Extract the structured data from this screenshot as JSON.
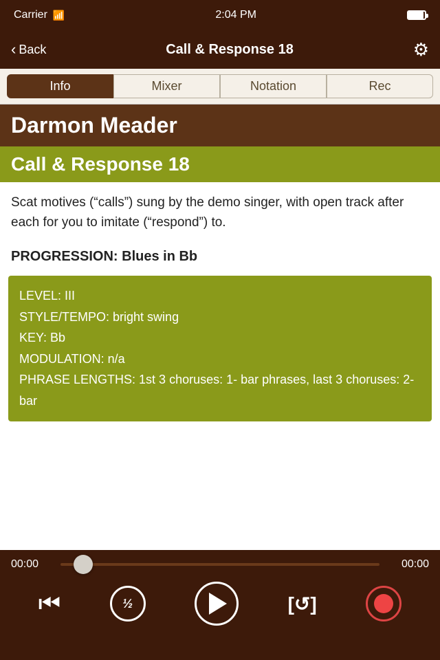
{
  "statusBar": {
    "carrier": "Carrier",
    "time": "2:04 PM"
  },
  "navBar": {
    "backLabel": "Back",
    "title": "Call & Response 18",
    "gearIcon": "⚙"
  },
  "tabs": [
    {
      "id": "info",
      "label": "Info",
      "active": true
    },
    {
      "id": "mixer",
      "label": "Mixer",
      "active": false
    },
    {
      "id": "notation",
      "label": "Notation",
      "active": false
    },
    {
      "id": "rec",
      "label": "Rec",
      "active": false
    }
  ],
  "content": {
    "artistName": "Darmon Meader",
    "songTitle": "Call & Response 18",
    "description": "Scat motives (“calls”) sung by the demo singer, with open track after each for you to imitate (“respond”) to.",
    "progressionLabel": "PROGRESSION: Blues in Bb",
    "details": [
      "LEVEL: III",
      "STYLE/TEMPO: bright swing",
      "KEY: Bb",
      "MODULATION: n/a",
      "PHRASE LENGTHS: 1st 3 choruses: 1- bar phrases, last 3 choruses: 2-bar"
    ]
  },
  "player": {
    "timeStart": "00:00",
    "timeEnd": "00:00",
    "controls": {
      "skipBack": "⏮",
      "halfSpeed": "½",
      "play": "play",
      "loop": "[↺]",
      "record": "record"
    }
  }
}
